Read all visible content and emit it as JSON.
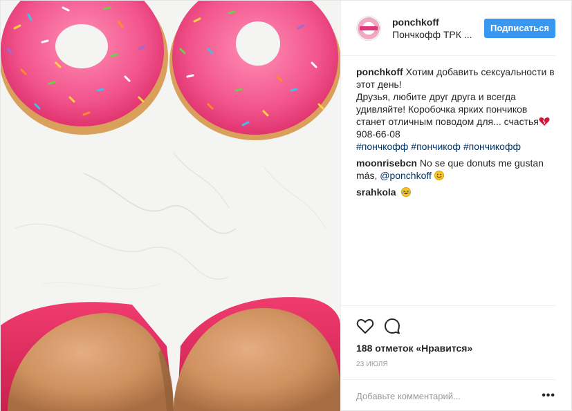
{
  "post": {
    "header": {
      "username": "ponchkoff",
      "location": "Пончкофф ТРК ...",
      "follow_label": "Подписаться",
      "avatar_text": "ponchkoff"
    },
    "caption": {
      "author": "ponchkoff",
      "text": "Хотим добавить сексуальности в этот день!\nДрузья, любите друг друга и всегда удивляйте! Коробочка ярких пончиков станет отличным поводом для... счастья",
      "phone": "908-66-08",
      "hashtags": [
        "#пончкофф",
        "#пончикоф",
        "#пончикофф"
      ]
    },
    "comments": [
      {
        "author": "moonrisebcn",
        "text": "No se que donuts me gustan más,",
        "mention": "@ponchkoff"
      },
      {
        "author": "srahkola",
        "text": ""
      }
    ],
    "likes_text": "188 отметок «Нравится»",
    "date": "23 июля",
    "comment_placeholder": "Добавьте комментарий...",
    "more_label": "•••",
    "icons": {
      "like": "heart-outline-icon",
      "comment": "speech-bubble-icon",
      "options": "more-options-icon"
    },
    "colors": {
      "follow_button": "#3897f0",
      "hashtag": "#003569",
      "donut_glaze": "#f0508a"
    }
  }
}
